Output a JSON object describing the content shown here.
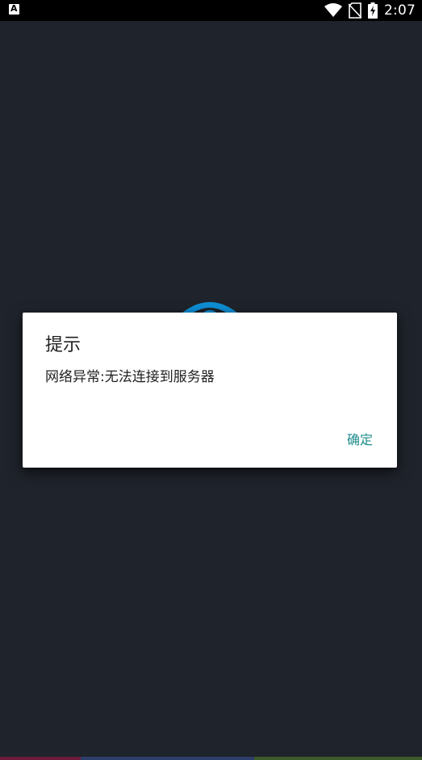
{
  "status_bar": {
    "time": "2:07",
    "left_icon": "notification-a-icon",
    "icons": [
      "wifi-icon",
      "no-sim-icon",
      "battery-charging-icon"
    ]
  },
  "dialog": {
    "title": "提示",
    "message": "网络异常:无法连接到服务器",
    "ok_label": "确定"
  },
  "colors": {
    "background": "#1f232b",
    "dialog_button": "#1e8c8c",
    "logo": "#0e8fd6",
    "strip": [
      "#6b1a3a",
      "#2e3e6a",
      "#3d5a2a"
    ]
  }
}
